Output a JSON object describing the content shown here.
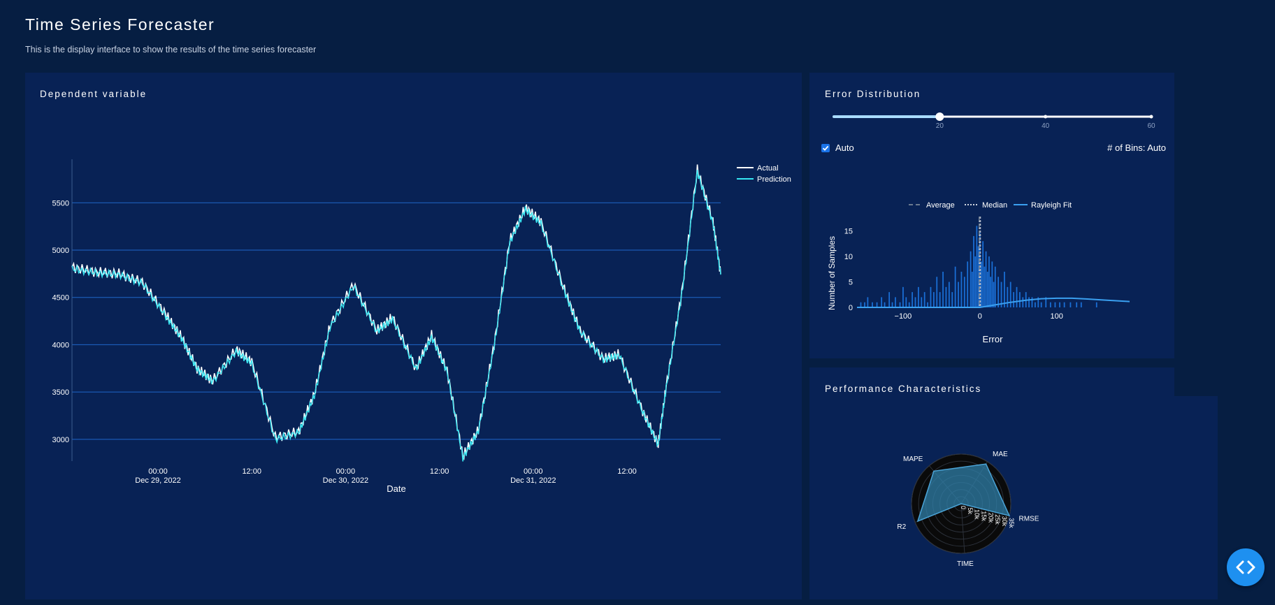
{
  "header": {
    "title": "Time Series Forecaster",
    "subtitle": "This is the display interface to show the results of the time series forecaster"
  },
  "colors": {
    "background": "#061e42",
    "panel": "#082255",
    "gridline": "#1f66c9",
    "actual_line": "#ffffff",
    "prediction_line": "#36e6f2",
    "histogram": "#1a6fd6",
    "rayleigh": "#3aa0f0",
    "radar_fill": "#2f7fa8",
    "fab": "#1e90f0"
  },
  "main_chart": {
    "panel_title": "Dependent variable",
    "chart_data": {
      "type": "line",
      "x_axis": {
        "label": "Date",
        "range": [
          "2022-12-28 13:00",
          "2022-12-31 23:59"
        ],
        "ticks": [
          {
            "at": "2022-12-29 00:00",
            "line1": "00:00",
            "line2": "Dec 29, 2022"
          },
          {
            "at": "2022-12-29 12:00",
            "line1": "12:00",
            "line2": ""
          },
          {
            "at": "2022-12-30 00:00",
            "line1": "00:00",
            "line2": "Dec 30, 2022"
          },
          {
            "at": "2022-12-30 12:00",
            "line1": "12:00",
            "line2": ""
          },
          {
            "at": "2022-12-31 00:00",
            "line1": "00:00",
            "line2": "Dec 31, 2022"
          },
          {
            "at": "2022-12-31 12:00",
            "line1": "12:00",
            "line2": ""
          }
        ]
      },
      "y_axis": {
        "label": "",
        "range": [
          2770,
          5960
        ],
        "ticks": [
          3000,
          3500,
          4000,
          4500,
          5000,
          5500
        ]
      },
      "grid": true,
      "legend": {
        "position": "top-right",
        "entries": [
          "Actual",
          "Prediction"
        ]
      },
      "series": [
        {
          "name": "Actual",
          "x": [
            "2022-12-28 13:00",
            "2022-12-28 16:00",
            "2022-12-28 19:00",
            "2022-12-28 22:00",
            "2022-12-29 01:00",
            "2022-12-29 03:00",
            "2022-12-29 05:00",
            "2022-12-29 07:00",
            "2022-12-29 10:00",
            "2022-12-29 12:00",
            "2022-12-29 15:00",
            "2022-12-29 18:00",
            "2022-12-29 20:00",
            "2022-12-29 22:00",
            "2022-12-30 01:00",
            "2022-12-30 04:00",
            "2022-12-30 06:00",
            "2022-12-30 09:00",
            "2022-12-30 11:00",
            "2022-12-30 13:00",
            "2022-12-30 15:00",
            "2022-12-30 17:00",
            "2022-12-30 19:00",
            "2022-12-30 21:00",
            "2022-12-30 23:00",
            "2022-12-31 01:00",
            "2022-12-31 04:00",
            "2022-12-31 06:00",
            "2022-12-31 09:00",
            "2022-12-31 11:00",
            "2022-12-31 14:00",
            "2022-12-31 16:00",
            "2022-12-31 17:00",
            "2022-12-31 19:00",
            "2022-12-31 21:00",
            "2022-12-31 23:00",
            "2022-12-31 23:59"
          ],
          "y": [
            4820,
            4770,
            4750,
            4660,
            4320,
            4080,
            3750,
            3620,
            3950,
            3820,
            3020,
            3080,
            3480,
            4200,
            4640,
            4150,
            4290,
            3750,
            4100,
            3720,
            2820,
            3100,
            4000,
            5100,
            5450,
            5300,
            4580,
            4150,
            3850,
            3900,
            3300,
            2950,
            3550,
            4550,
            5850,
            5300,
            4750
          ]
        },
        {
          "name": "Prediction",
          "x": [
            "2022-12-28 13:00",
            "2022-12-28 16:00",
            "2022-12-28 19:00",
            "2022-12-28 22:00",
            "2022-12-29 01:00",
            "2022-12-29 03:00",
            "2022-12-29 05:00",
            "2022-12-29 07:00",
            "2022-12-29 10:00",
            "2022-12-29 12:00",
            "2022-12-29 15:00",
            "2022-12-29 18:00",
            "2022-12-29 20:00",
            "2022-12-29 22:00",
            "2022-12-30 01:00",
            "2022-12-30 04:00",
            "2022-12-30 06:00",
            "2022-12-30 09:00",
            "2022-12-30 11:00",
            "2022-12-30 13:00",
            "2022-12-30 15:00",
            "2022-12-30 17:00",
            "2022-12-30 19:00",
            "2022-12-30 21:00",
            "2022-12-30 23:00",
            "2022-12-31 01:00",
            "2022-12-31 04:00",
            "2022-12-31 06:00",
            "2022-12-31 09:00",
            "2022-12-31 11:00",
            "2022-12-31 14:00",
            "2022-12-31 16:00",
            "2022-12-31 17:00",
            "2022-12-31 19:00",
            "2022-12-31 21:00",
            "2022-12-31 23:00",
            "2022-12-31 23:59"
          ],
          "y": [
            4800,
            4760,
            4740,
            4650,
            4300,
            4070,
            3740,
            3610,
            3930,
            3800,
            3000,
            3070,
            3460,
            4180,
            4620,
            4140,
            4270,
            3740,
            4080,
            3710,
            2800,
            3090,
            3980,
            5080,
            5430,
            5280,
            4560,
            4140,
            3840,
            3890,
            3290,
            2940,
            3540,
            4530,
            5830,
            5280,
            4740
          ]
        }
      ]
    }
  },
  "error_distribution": {
    "panel_title": "Error Distribution",
    "slider": {
      "min": 0,
      "max": 60,
      "value": 20,
      "marks": [
        20,
        40,
        60
      ]
    },
    "auto_checkbox": {
      "label": "Auto",
      "checked": true
    },
    "bins_label": "# of Bins: Auto",
    "chart_data": {
      "type": "bar",
      "legend": {
        "position": "top-center",
        "entries": [
          "Average",
          "Median",
          "Rayleigh Fit"
        ]
      },
      "xlabel": "Error",
      "ylabel": "Number of Samples",
      "x_range": [
        -160,
        195
      ],
      "y_range": [
        0,
        17
      ],
      "x_ticks": [
        {
          "value": -100,
          "label": "−100"
        },
        {
          "value": 0,
          "label": "0"
        },
        {
          "value": 100,
          "label": "100"
        }
      ],
      "y_ticks": [
        0,
        5,
        10,
        15
      ],
      "average": 0,
      "median": 0,
      "bin_width": 2,
      "bins": [
        {
          "x": -155,
          "count": 1
        },
        {
          "x": -150,
          "count": 1
        },
        {
          "x": -146,
          "count": 2
        },
        {
          "x": -140,
          "count": 1
        },
        {
          "x": -134,
          "count": 1
        },
        {
          "x": -128,
          "count": 2
        },
        {
          "x": -124,
          "count": 1
        },
        {
          "x": -118,
          "count": 3
        },
        {
          "x": -114,
          "count": 1
        },
        {
          "x": -110,
          "count": 2
        },
        {
          "x": -104,
          "count": 1
        },
        {
          "x": -100,
          "count": 4
        },
        {
          "x": -96,
          "count": 2
        },
        {
          "x": -92,
          "count": 1
        },
        {
          "x": -88,
          "count": 3
        },
        {
          "x": -84,
          "count": 2
        },
        {
          "x": -80,
          "count": 4
        },
        {
          "x": -76,
          "count": 2
        },
        {
          "x": -72,
          "count": 3
        },
        {
          "x": -68,
          "count": 1
        },
        {
          "x": -64,
          "count": 4
        },
        {
          "x": -60,
          "count": 3
        },
        {
          "x": -56,
          "count": 6
        },
        {
          "x": -52,
          "count": 3
        },
        {
          "x": -48,
          "count": 7
        },
        {
          "x": -44,
          "count": 4
        },
        {
          "x": -40,
          "count": 5
        },
        {
          "x": -36,
          "count": 3
        },
        {
          "x": -32,
          "count": 8
        },
        {
          "x": -28,
          "count": 5
        },
        {
          "x": -24,
          "count": 7
        },
        {
          "x": -20,
          "count": 6
        },
        {
          "x": -16,
          "count": 9
        },
        {
          "x": -12,
          "count": 11
        },
        {
          "x": -10,
          "count": 7
        },
        {
          "x": -8,
          "count": 14
        },
        {
          "x": -6,
          "count": 10
        },
        {
          "x": -4,
          "count": 16
        },
        {
          "x": -2,
          "count": 12
        },
        {
          "x": 0,
          "count": 15
        },
        {
          "x": 2,
          "count": 9
        },
        {
          "x": 4,
          "count": 13
        },
        {
          "x": 6,
          "count": 8
        },
        {
          "x": 8,
          "count": 11
        },
        {
          "x": 10,
          "count": 7
        },
        {
          "x": 12,
          "count": 10
        },
        {
          "x": 14,
          "count": 6
        },
        {
          "x": 16,
          "count": 9
        },
        {
          "x": 18,
          "count": 5
        },
        {
          "x": 20,
          "count": 8
        },
        {
          "x": 24,
          "count": 6
        },
        {
          "x": 28,
          "count": 5
        },
        {
          "x": 32,
          "count": 7
        },
        {
          "x": 36,
          "count": 4
        },
        {
          "x": 40,
          "count": 5
        },
        {
          "x": 44,
          "count": 3
        },
        {
          "x": 48,
          "count": 4
        },
        {
          "x": 52,
          "count": 3
        },
        {
          "x": 56,
          "count": 2
        },
        {
          "x": 60,
          "count": 3
        },
        {
          "x": 64,
          "count": 2
        },
        {
          "x": 68,
          "count": 2
        },
        {
          "x": 72,
          "count": 1
        },
        {
          "x": 76,
          "count": 2
        },
        {
          "x": 80,
          "count": 1
        },
        {
          "x": 86,
          "count": 2
        },
        {
          "x": 92,
          "count": 1
        },
        {
          "x": 98,
          "count": 1
        },
        {
          "x": 104,
          "count": 1
        },
        {
          "x": 110,
          "count": 1
        },
        {
          "x": 118,
          "count": 1
        },
        {
          "x": 126,
          "count": 1
        },
        {
          "x": 132,
          "count": 1
        },
        {
          "x": 152,
          "count": 1
        }
      ],
      "rayleigh_fit": {
        "x": [
          -160,
          0,
          20,
          40,
          60,
          80,
          100,
          120,
          140,
          160,
          195
        ],
        "y": [
          0,
          0,
          0.5,
          1.0,
          1.4,
          1.7,
          1.8,
          1.8,
          1.65,
          1.45,
          1.15
        ]
      }
    }
  },
  "performance": {
    "panel_title": "Performance Characteristics",
    "chart_data": {
      "type": "radar",
      "axes": [
        "MAE",
        "RMSE",
        "TIME",
        "R2",
        "MAPE"
      ],
      "radial_range": [
        0,
        35000
      ],
      "radial_ticks": [
        "0",
        "5k",
        "10k",
        "15k",
        "20k",
        "25k",
        "30k",
        "35k"
      ],
      "values": [
        33000,
        35000,
        0,
        33000,
        30000
      ]
    }
  }
}
